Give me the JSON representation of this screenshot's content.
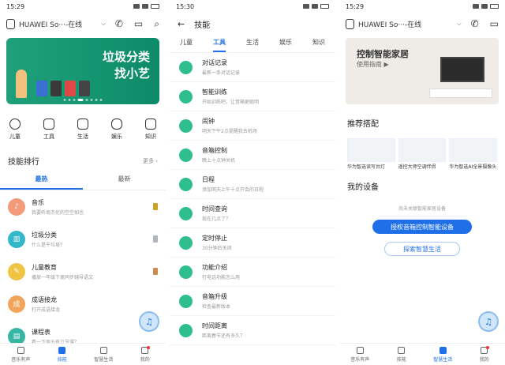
{
  "screen1": {
    "status": {
      "time": "15:29"
    },
    "header": {
      "device": "HUAWEI So···-在线"
    },
    "banner": {
      "line1": "垃圾分类",
      "line2": "找小艺"
    },
    "categories": [
      "儿童",
      "工具",
      "生活",
      "娱乐",
      "知识"
    ],
    "section": {
      "title": "技能排行",
      "more": "更多"
    },
    "tabs": [
      "最热",
      "最新"
    ],
    "skills": [
      {
        "name": "音乐",
        "desc": "我要听周杰伦的空空如也",
        "color": "#f29a7a"
      },
      {
        "name": "垃圾分类",
        "desc": "什么是干垃圾？",
        "color": "#33b7c9"
      },
      {
        "name": "儿童教育",
        "desc": "播放一年级下册同步辅导语文",
        "color": "#f0c443"
      },
      {
        "name": "成语接龙",
        "desc": "打开成语接龙",
        "color": "#f2a55a"
      },
      {
        "name": "课程表",
        "desc": "看一下周五有几节课？",
        "color": "#37b6a6"
      }
    ],
    "nav": [
      "音乐有声",
      "技能",
      "智慧生活",
      "我的"
    ]
  },
  "screen2": {
    "status": {
      "time": "15:30"
    },
    "header": {
      "title": "技能"
    },
    "tabs": [
      "儿童",
      "工具",
      "生活",
      "娱乐",
      "知识"
    ],
    "items": [
      {
        "name": "对话记录",
        "desc": "最新一条对话记录"
      },
      {
        "name": "智能训练",
        "desc": "开始训练吧，让音箱更聪明"
      },
      {
        "name": "闹钟",
        "desc": "明天下午2点提醒我去机场"
      },
      {
        "name": "音箱控制",
        "desc": "晚上十点钟关机"
      },
      {
        "name": "日程",
        "desc": "添加明天上午十点开会的日程"
      },
      {
        "name": "时间查询",
        "desc": "现在几点了？"
      },
      {
        "name": "定时停止",
        "desc": "30分钟后关闭"
      },
      {
        "name": "功能介绍",
        "desc": "打电话功能怎么用"
      },
      {
        "name": "音箱升级",
        "desc": "检查最新版本"
      },
      {
        "name": "时间距离",
        "desc": "距离春节还有多久？"
      }
    ]
  },
  "screen3": {
    "status": {
      "time": "15:29"
    },
    "header": {
      "device": "HUAWEI So···-在线"
    },
    "banner": {
      "title": "控制智能家居",
      "sub": "使用指南 ▶"
    },
    "recommend": {
      "title": "推荐搭配",
      "products": [
        "华为智选读写台灯",
        "遥控大师空调伴侣",
        "华为智选AI全景摄像头"
      ]
    },
    "devices": {
      "title": "我的设备",
      "empty": "尚未关联智能家居设备",
      "auth_button": "授权音箱控制智能设备",
      "explore_button": "探索智慧生活"
    },
    "nav": [
      "音乐有声",
      "技能",
      "智慧生活",
      "我的"
    ]
  }
}
